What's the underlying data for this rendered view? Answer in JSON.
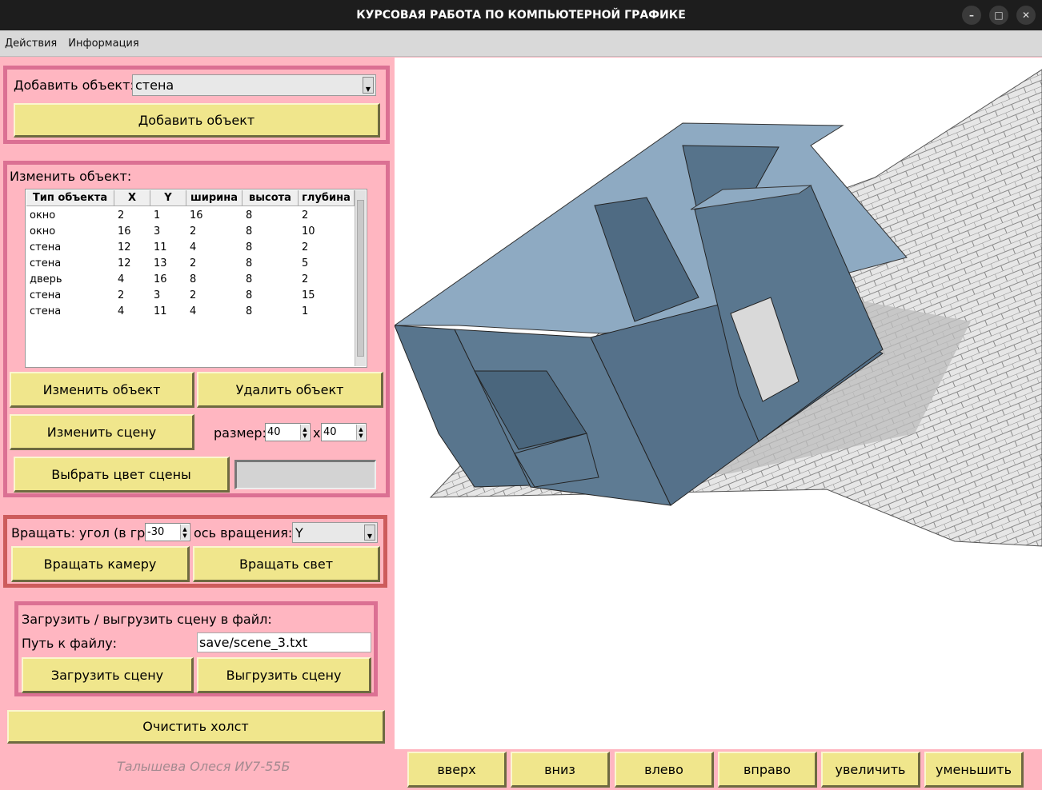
{
  "window": {
    "title": "КУРСОВАЯ РАБОТА ПО КОМПЬЮТЕРНОЙ ГРАФИКЕ"
  },
  "menu": [
    "Действия",
    "Информация"
  ],
  "add": {
    "label": "Добавить объект:",
    "selected": "стена",
    "button": "Добавить объект"
  },
  "edit": {
    "label": "Изменить объект:",
    "columns": [
      "Тип объекта",
      "X",
      "Y",
      "ширина",
      "высота",
      "глубина"
    ],
    "rows": [
      [
        "окно",
        "2",
        "1",
        "16",
        "8",
        "2"
      ],
      [
        "окно",
        "16",
        "3",
        "2",
        "8",
        "10"
      ],
      [
        "стена",
        "12",
        "11",
        "4",
        "8",
        "2"
      ],
      [
        "стена",
        "12",
        "13",
        "2",
        "8",
        "5"
      ],
      [
        "дверь",
        "4",
        "16",
        "8",
        "8",
        "2"
      ],
      [
        "стена",
        "2",
        "3",
        "2",
        "8",
        "15"
      ],
      [
        "стена",
        "4",
        "11",
        "4",
        "8",
        "1"
      ]
    ],
    "edit_button": "Изменить объект",
    "delete_button": "Удалить объект",
    "scene_button": "Изменить сцену",
    "size_label": "размер:",
    "size_w": "40",
    "size_x": "x",
    "size_h": "40",
    "color_button": "Выбрать цвет сцены",
    "scene_color": "#d3d3d3"
  },
  "rotate": {
    "angle_label": "Вращать: угол (в гр.):",
    "angle": "-30",
    "axis_label": "ось вращения:",
    "axis": "Y",
    "camera_button": "Вращать камеру",
    "light_button": "Вращать свет"
  },
  "file": {
    "label": "Загрузить / выгрузить сцену в файл:",
    "path_label": "Путь к файлу:",
    "path": "save/scene_3.txt",
    "load_button": "Загрузить сцену",
    "save_button": "Выгрузить сцену"
  },
  "clear_button": "Очистить холст",
  "author": "Талышева Олеся ИУ7-55Б",
  "nav": [
    "вверх",
    "вниз",
    "влево",
    "вправо",
    "увеличить",
    "уменьшить"
  ],
  "colors": {
    "panel": "#ffb6c1",
    "frame": "#db7093",
    "frame_rotate": "#cd5c5c",
    "button": "#f0e68c",
    "object": "#5b7890",
    "grid": "#d0d0d0"
  }
}
